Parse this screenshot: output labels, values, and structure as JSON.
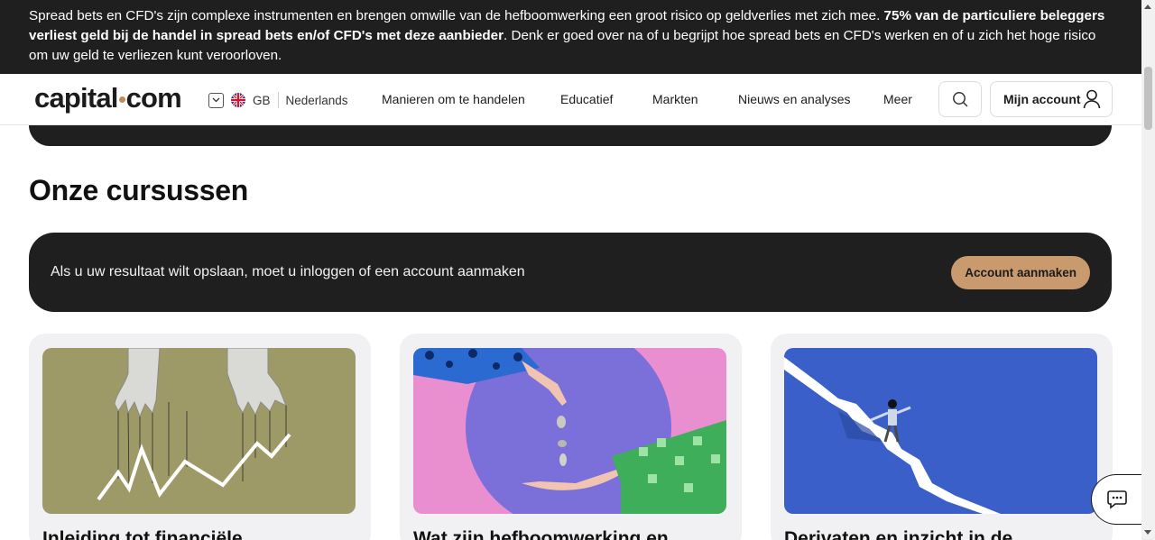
{
  "risk_banner": {
    "text_start": "Spread bets en CFD's zijn complexe instrumenten en brengen omwille van de hefboomwerking een groot risico op geldverlies met zich mee. ",
    "text_bold": "75% van de particuliere beleggers verliest geld bij de handel in spread bets en/of CFD's met deze aanbieder",
    "text_end": ". Denk er goed over na of u begrijpt hoe spread bets en CFD's werken en of u zich het hoge risico om uw geld te verliezen kunt veroorloven."
  },
  "header": {
    "logo_left": "capital",
    "logo_right": "com",
    "region_code": "GB",
    "language": "Nederlands",
    "nav": [
      "Manieren om te handelen",
      "Educatief",
      "Markten",
      "Nieuws en analyses",
      "Meer"
    ],
    "account_label": "Mijn account",
    "icons": [
      "chevron-down-icon",
      "uk-flag-icon",
      "search-icon",
      "user-icon"
    ]
  },
  "main": {
    "section_title": "Onze cursussen",
    "login_prompt": "Als u uw resultaat wilt opslaan, moet u inloggen of een account aanmaken",
    "create_account_button": "Account aanmaken",
    "courses": [
      {
        "title": "Inleiding tot financiële"
      },
      {
        "title": "Wat zijn hefboomwerking en"
      },
      {
        "title": "Derivaten en inzicht in de"
      }
    ]
  },
  "colors": {
    "dark": "#1f1f1f",
    "accent": "#c89a6e",
    "card_bg": "#f1f1f3"
  },
  "chat": {
    "icon": "chat-icon"
  }
}
